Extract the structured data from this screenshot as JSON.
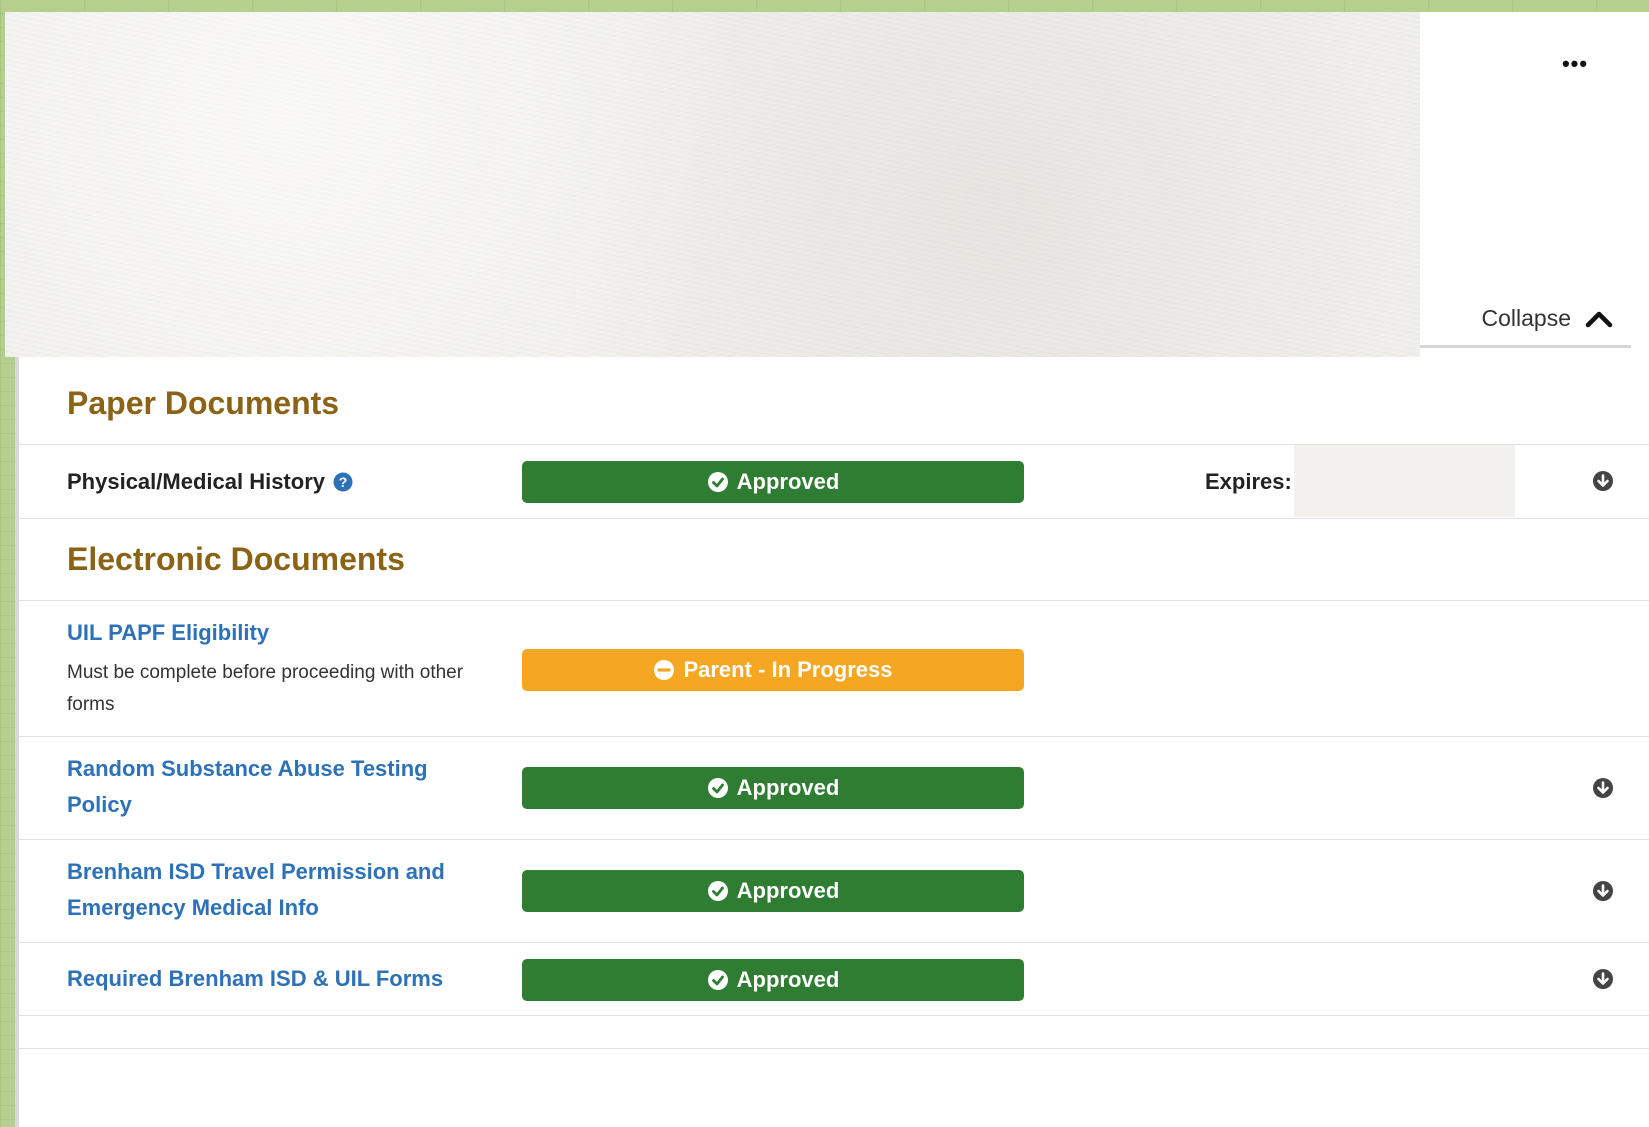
{
  "header": {
    "more_label": "•••",
    "collapse_label": "Collapse"
  },
  "paper_documents": {
    "heading": "Paper Documents",
    "items": [
      {
        "title": "Physical/Medical History",
        "status": "Approved",
        "expires_label": "Expires:"
      }
    ]
  },
  "electronic_documents": {
    "heading": "Electronic Documents",
    "items": [
      {
        "title": "UIL PAPF Eligibility",
        "note": "Must be complete before proceeding with other forms",
        "status": "Parent - In Progress"
      },
      {
        "title": "Random Substance Abuse Testing Policy",
        "status": "Approved"
      },
      {
        "title": "Brenham ISD Travel Permission and Emergency Medical Info",
        "status": "Approved"
      },
      {
        "title": "Required Brenham ISD & UIL Forms",
        "status": "Approved"
      }
    ]
  },
  "colors": {
    "approved": "#2e7d32",
    "in_progress": "#f5a623",
    "heading": "#8a6316",
    "link": "#2d72b8"
  },
  "icons": {
    "more": "ellipsis-icon",
    "collapse": "chevron-up-icon",
    "help": "question-circle-icon",
    "approved": "check-circle-icon",
    "in_progress": "minus-circle-icon",
    "download": "arrow-down-circle-icon"
  }
}
